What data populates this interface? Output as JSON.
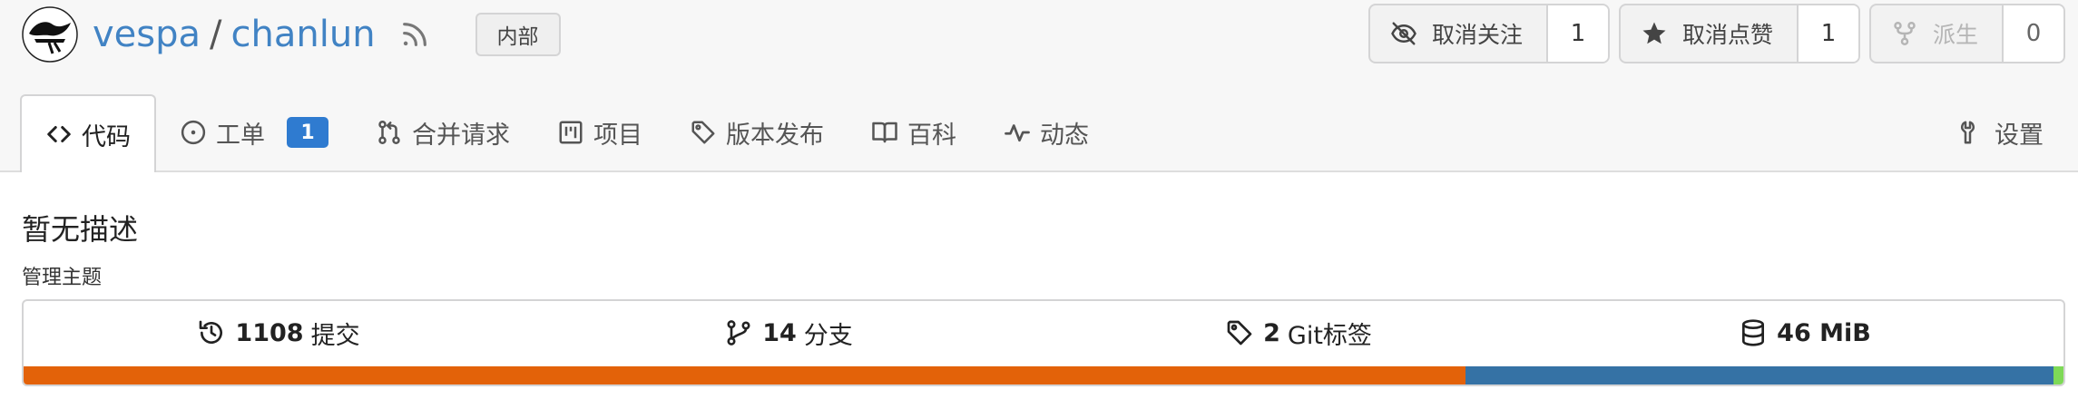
{
  "repo": {
    "owner": "vespa",
    "separator": "/",
    "name": "chanlun",
    "visibility_badge": "内部"
  },
  "actions": {
    "watch": {
      "label": "取消关注",
      "count": "1",
      "icon": "eye-slash-icon"
    },
    "star": {
      "label": "取消点赞",
      "count": "1",
      "icon": "star-icon"
    },
    "fork": {
      "label": "派生",
      "count": "0",
      "icon": "fork-icon",
      "disabled": true
    }
  },
  "tabs": [
    {
      "label": "代码",
      "icon": "code-icon",
      "active": true
    },
    {
      "label": "工单",
      "icon": "issue-opened-icon",
      "badge": "1"
    },
    {
      "label": "合并请求",
      "icon": "git-pull-request-icon"
    },
    {
      "label": "项目",
      "icon": "project-icon"
    },
    {
      "label": "版本发布",
      "icon": "tag-icon"
    },
    {
      "label": "百科",
      "icon": "book-icon"
    },
    {
      "label": "动态",
      "icon": "pulse-icon"
    }
  ],
  "settings_tab": {
    "label": "设置",
    "icon": "tools-icon"
  },
  "description": "暂无描述",
  "manage_topics": "管理主题",
  "stats": {
    "commits": {
      "count": "1108",
      "label": "提交"
    },
    "branches": {
      "count": "14",
      "label": "分支"
    },
    "tags": {
      "count": "2",
      "label": "Git标签"
    },
    "size": {
      "value": "46 MiB"
    }
  },
  "language_bar": [
    {
      "color": "#e36209",
      "fraction": 0.707
    },
    {
      "color": "#3572a5",
      "fraction": 0.288
    },
    {
      "color": "#7ed957",
      "fraction": 0.005
    }
  ],
  "colors": {
    "link": "#4183c4",
    "badge": "#2f7bd0"
  }
}
